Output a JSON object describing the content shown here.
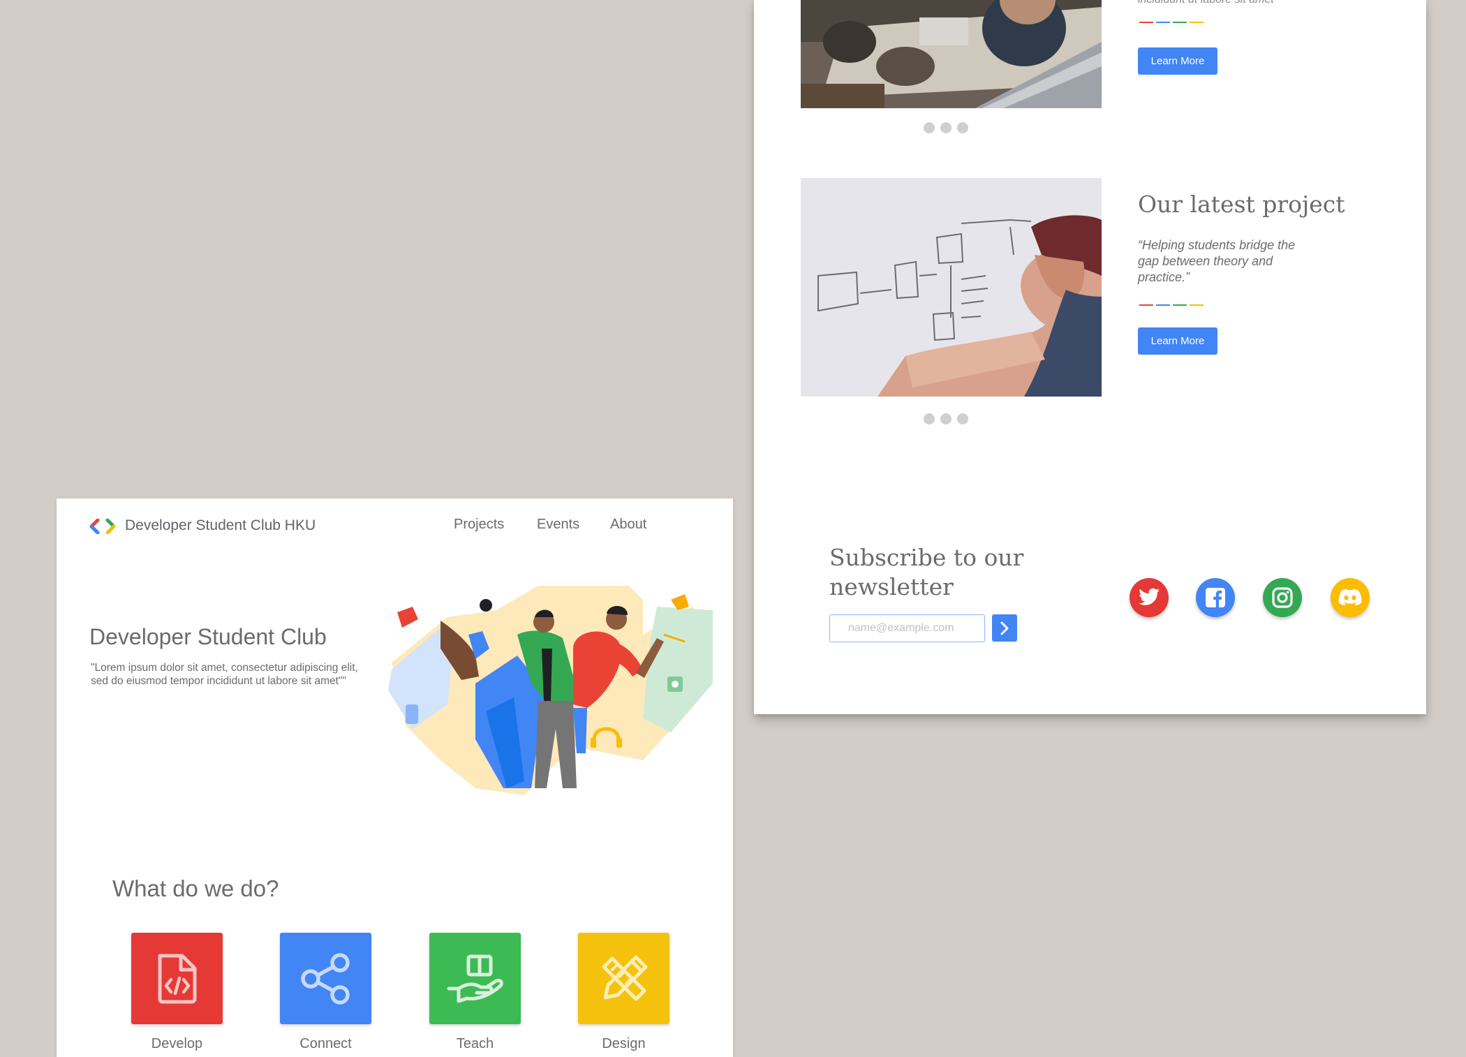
{
  "colors": {
    "background": "#d4cdc7",
    "blue": "#4285f4",
    "red": "#ea4335",
    "green": "#34a853",
    "yellow": "#fbbc04",
    "tile_red": "#e53935",
    "tile_green": "#3cba54",
    "tile_yellow": "#f4c20d"
  },
  "projects": [
    {
      "title": "",
      "quote": "incididunt ut labore sit amet\"",
      "button_label": "Learn More",
      "image": "people-at-laptops-photo"
    },
    {
      "title": "Our latest project",
      "quote": "“Helping students bridge the gap between theory and practice.”",
      "button_label": "Learn More",
      "image": "whiteboard-photo"
    }
  ],
  "newsletter": {
    "title": "Subscribe to our newsletter",
    "placeholder": "name@example.com",
    "submit_icon": "chevron-right-icon"
  },
  "social": [
    {
      "name": "twitter",
      "icon": "twitter-icon",
      "color": "#e53935"
    },
    {
      "name": "facebook",
      "icon": "facebook-icon",
      "color": "#4285f4"
    },
    {
      "name": "instagram",
      "icon": "instagram-icon",
      "color": "#34a853"
    },
    {
      "name": "discord",
      "icon": "discord-icon",
      "color": "#fbbc04"
    }
  ],
  "header": {
    "brand": "Developer Student Club HKU",
    "nav": [
      "Projects",
      "Events",
      "About"
    ]
  },
  "hero": {
    "title": "Developer Student Club",
    "subtitle": "\"Lorem ipsum dolor sit amet, consectetur adipiscing elit, sed do eiusmod tempor incididunt ut labore sit amet\"\"",
    "illustration": "people-illustration"
  },
  "what": {
    "title": "What do we do?",
    "items": [
      {
        "label": "Develop",
        "icon": "code-file-icon",
        "color": "#e53935"
      },
      {
        "label": "Connect",
        "icon": "share-nodes-icon",
        "color": "#4285f4"
      },
      {
        "label": "Teach",
        "icon": "hand-book-icon",
        "color": "#3cba54"
      },
      {
        "label": "Design",
        "icon": "pencil-ruler-icon",
        "color": "#f4c20d"
      }
    ]
  }
}
